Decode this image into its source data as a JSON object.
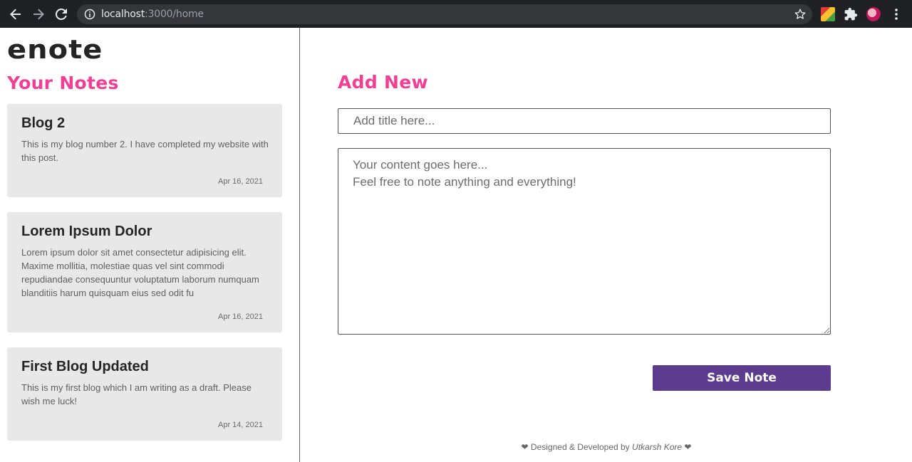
{
  "browser": {
    "url_host": "localhost",
    "url_rest": ":3000/home"
  },
  "app": {
    "logo": "enote",
    "notes_heading": "Your Notes",
    "add_heading": "Add New"
  },
  "notes": [
    {
      "title": "Blog 2",
      "body": "This is my blog number 2. I have completed my website with this post.",
      "date": "Apr 16, 2021"
    },
    {
      "title": "Lorem Ipsum Dolor",
      "body": "Lorem ipsum dolor sit amet consectetur adipisicing elit. Maxime mollitia, molestiae quas vel sint commodi repudiandae consequuntur voluptatum laborum numquam blanditiis harum quisquam eius sed odit fu",
      "date": "Apr 16, 2021"
    },
    {
      "title": "First Blog Updated",
      "body": "This is my first blog which I am writing as a draft. Please wish me luck!",
      "date": "Apr 14, 2021"
    }
  ],
  "form": {
    "title_placeholder": "Add title here...",
    "content_placeholder": "Your content goes here...\nFeel free to note anything and everything!",
    "save_label": "Save Note"
  },
  "footer": {
    "prefix": "Designed & Developed by",
    "author": "Utkarsh Kore",
    "heart": "❤"
  },
  "icons": {
    "back": "back-arrow-icon",
    "forward": "forward-arrow-icon",
    "reload": "reload-icon",
    "info": "info-icon",
    "star": "star-icon",
    "puzzle": "puzzle-icon",
    "menu": "kebab-menu-icon"
  },
  "colors": {
    "accent_pink": "#f23f95",
    "button_purple": "#5d3b8e",
    "card_bg": "#e8e8e8"
  }
}
